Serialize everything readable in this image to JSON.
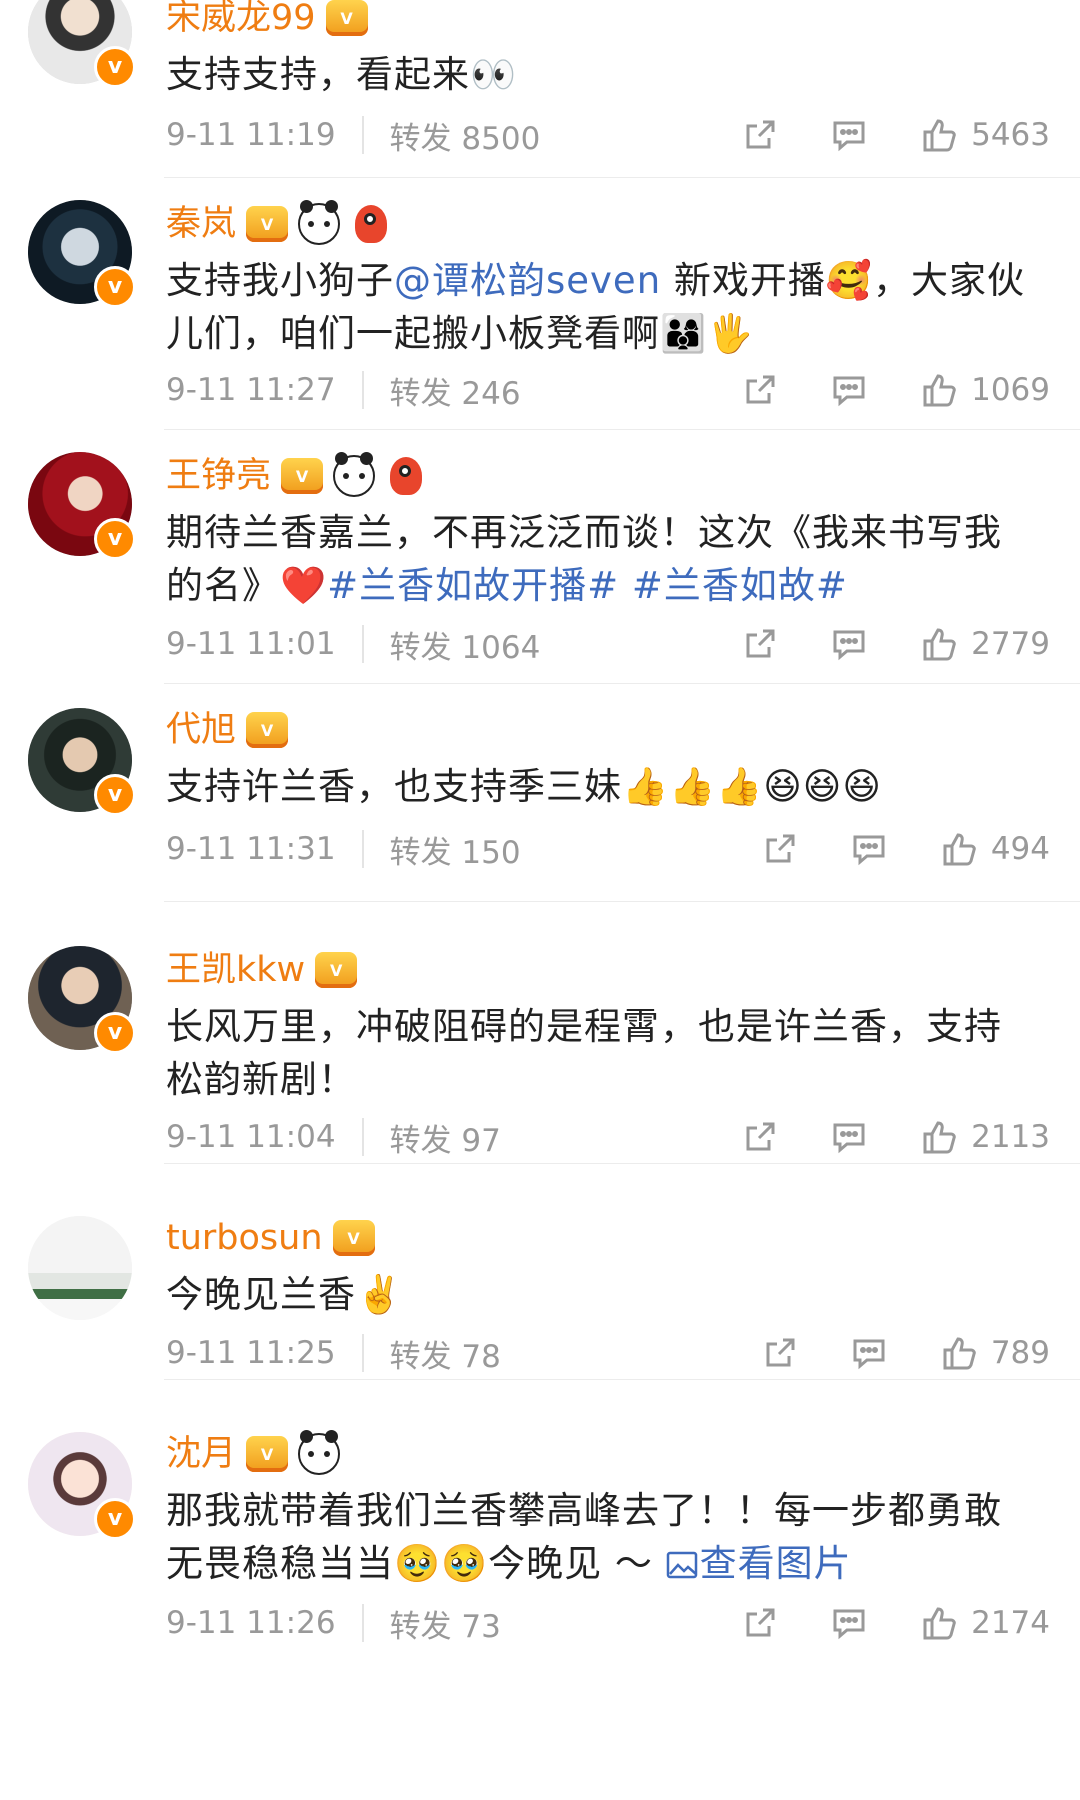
{
  "labels": {
    "repost": "转发"
  },
  "comments": [
    {
      "name": "宋威龙99",
      "text_parts": [
        "支持支持，看起来"
      ],
      "emoji": "👀",
      "time": "9-11 11:19",
      "reposts": "8500",
      "likes": "5463"
    },
    {
      "name": "秦岚",
      "text_before": "支持我小狗子",
      "mention": "@谭松韵seven",
      "text_after": " 新戏开播",
      "emoji1": "🥰",
      "text_end": "，大家伙儿们，咱们一起搬小板凳看啊",
      "emoji2": "👨‍👩‍👦",
      "emoji3": "🖐️",
      "time": "9-11 11:27",
      "reposts": "246",
      "likes": "1069"
    },
    {
      "name": "王铮亮",
      "text_before": "期待兰香嘉兰，不再泛泛而谈！这次《我来书写我的名》",
      "emoji": "❤️",
      "tag1": "#兰香如故开播#",
      "tag2": "#兰香如故#",
      "time": "9-11 11:01",
      "reposts": "1064",
      "likes": "2779"
    },
    {
      "name": "代旭",
      "text": "支持许兰香，也支持季三妹",
      "emoji": "👍👍👍😆😆😆",
      "time": "9-11 11:31",
      "reposts": "150",
      "likes": "494"
    },
    {
      "name": "王凯kkw",
      "text": "长风万里，冲破阻碍的是程霄，也是许兰香，支持松韵新剧！",
      "time": "9-11 11:04",
      "reposts": "97",
      "likes": "2113"
    },
    {
      "name": "turbosun",
      "text": "今晚见兰香",
      "emoji": "✌️",
      "time": "9-11 11:25",
      "reposts": "78",
      "likes": "789"
    },
    {
      "name": "沈月",
      "text_before": "那我就带着我们兰香攀高峰去了！！每一步都勇敢无畏稳稳当当",
      "emoji": "🥹🥹",
      "text_after": "今晚见 ～ ",
      "link": "查看图片",
      "time": "9-11 11:26",
      "reposts": "73",
      "likes": "2174"
    }
  ],
  "colors": {
    "name": "#ef7d12",
    "link": "#3e6bbd",
    "meta": "#999999",
    "vbadge": "#ff8a00"
  }
}
